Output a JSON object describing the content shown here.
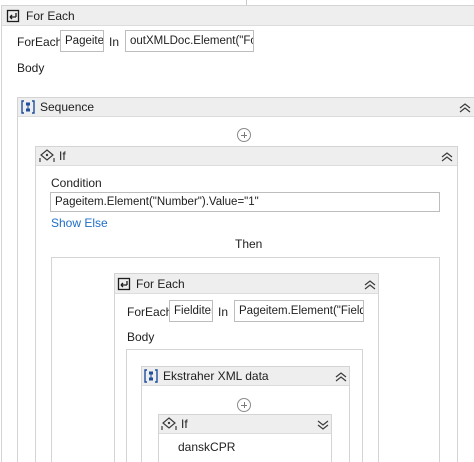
{
  "outer_foreach": {
    "title": "For Each",
    "foreach_label": "ForEach",
    "item_value": "Pageiter",
    "in_label": "In",
    "collection_value": "outXMLDoc.Element(\"Forr",
    "body_label": "Body"
  },
  "sequence": {
    "title": "Sequence"
  },
  "if_activity": {
    "title": "If",
    "condition_label": "Condition",
    "condition_value": "Pageitem.Element(\"Number\").Value=\"1\"",
    "show_else": "Show Else",
    "then_label": "Then"
  },
  "inner_foreach": {
    "title": "For Each",
    "foreach_label": "ForEach",
    "item_value": "Fielditen",
    "in_label": "In",
    "collection_value": "Pageitem.Element(\"Fields\"",
    "body_label": "Body"
  },
  "extract_xml": {
    "title": "Ekstraher XML data"
  },
  "inner_if": {
    "title": "If",
    "content_label": "danskCPR"
  },
  "icons": [
    "foreach-icon",
    "sequence-icon",
    "if-icon",
    "add-activity-icon",
    "collapse-icon",
    "expand-icon"
  ],
  "colors": {
    "header_bg": "#eeeeee",
    "border": "#d4d4d4",
    "link": "#1f6fc5",
    "icon_blue": "#1f4e9c"
  }
}
